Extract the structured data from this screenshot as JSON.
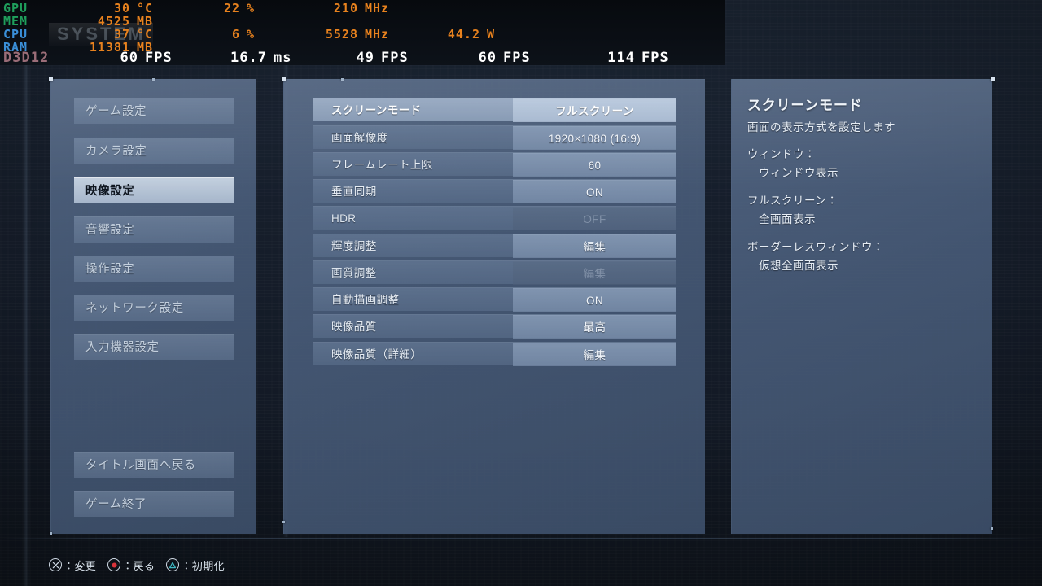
{
  "osd": {
    "rows": [
      {
        "label": "GPU",
        "color_class": "c-gpu",
        "temp": "30",
        "temp_unit": "°C",
        "load": "22",
        "load_unit": "%",
        "clock": "210",
        "clock_unit": "MHz",
        "power": "",
        "power_unit": ""
      },
      {
        "label": "MEM",
        "color_class": "c-mem",
        "temp": "4525",
        "temp_unit": "MB",
        "load": "",
        "load_unit": "",
        "clock": "",
        "clock_unit": "",
        "power": "",
        "power_unit": ""
      },
      {
        "label": "CPU",
        "color_class": "c-cpu",
        "temp": "37",
        "temp_unit": "°C",
        "load": "6",
        "load_unit": "%",
        "clock": "5528",
        "clock_unit": "MHz",
        "power": "44.2",
        "power_unit": "W"
      },
      {
        "label": "RAM",
        "color_class": "c-ram",
        "temp": "11381",
        "temp_unit": "MB",
        "load": "",
        "load_unit": "",
        "clock": "",
        "clock_unit": "",
        "power": "",
        "power_unit": ""
      }
    ],
    "api": "D3D12",
    "fps_now": "60",
    "fps_now_unit": "FPS",
    "frametime": "16.7",
    "frametime_unit": "ms",
    "fps_min": "49",
    "fps_min_unit": "FPS",
    "fps_avg": "60",
    "fps_avg_unit": "FPS",
    "fps_max": "114",
    "fps_max_unit": "FPS",
    "watermark": "SYSTEM",
    "accent_value": "#e8821e",
    "accent_fps": "#ffffff"
  },
  "sidebar": {
    "items": [
      {
        "label": "ゲーム設定",
        "active": false
      },
      {
        "label": "カメラ設定",
        "active": false
      },
      {
        "label": "映像設定",
        "active": true
      },
      {
        "label": "音響設定",
        "active": false
      },
      {
        "label": "操作設定",
        "active": false
      },
      {
        "label": "ネットワーク設定",
        "active": false
      },
      {
        "label": "入力機器設定",
        "active": false
      }
    ],
    "bottom_items": [
      {
        "label": "タイトル画面へ戻る"
      },
      {
        "label": "ゲーム終了"
      }
    ]
  },
  "settings": {
    "rows": [
      {
        "label": "スクリーンモード",
        "value": "フルスクリーン",
        "selected": true,
        "disabled": false
      },
      {
        "label": "画面解像度",
        "value": "1920×1080 (16:9)",
        "selected": false,
        "disabled": false
      },
      {
        "label": "フレームレート上限",
        "value": "60",
        "selected": false,
        "disabled": false
      },
      {
        "label": "垂直同期",
        "value": "ON",
        "selected": false,
        "disabled": false
      },
      {
        "label": "HDR",
        "value": "OFF",
        "selected": false,
        "disabled": true
      },
      {
        "label": "輝度調整",
        "value": "編集",
        "selected": false,
        "disabled": false
      },
      {
        "label": "画質調整",
        "value": "編集",
        "selected": false,
        "disabled": true
      },
      {
        "label": "自動描画調整",
        "value": "ON",
        "selected": false,
        "disabled": false
      },
      {
        "label": "映像品質",
        "value": "最高",
        "selected": false,
        "disabled": false
      },
      {
        "label": "映像品質（詳細）",
        "value": "編集",
        "selected": false,
        "disabled": false
      }
    ]
  },
  "help": {
    "title": "スクリーンモード",
    "description": "画面の表示方式を設定します",
    "items": [
      {
        "term": "ウィンドウ：",
        "definition": "ウィンドウ表示"
      },
      {
        "term": "フルスクリーン：",
        "definition": "全画面表示"
      },
      {
        "term": "ボーダーレスウィンドウ：",
        "definition": "仮想全画面表示"
      }
    ]
  },
  "footer": {
    "hints": [
      {
        "button": "cross",
        "glyph_name": "cross-button-icon",
        "label": "：変更",
        "color": "#cfd9e4"
      },
      {
        "button": "circle",
        "glyph_name": "circle-button-icon",
        "label": "：戻る",
        "color": "#d8333a"
      },
      {
        "button": "triangle",
        "glyph_name": "triangle-button-icon",
        "label": "：初期化",
        "color": "#3fb9c4"
      }
    ]
  }
}
